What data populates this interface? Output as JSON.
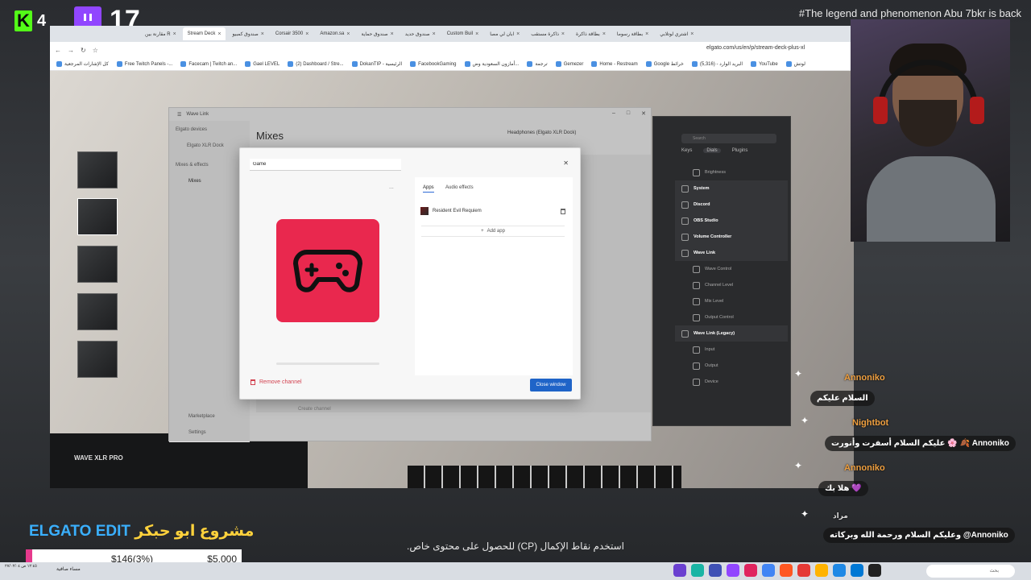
{
  "overlay": {
    "kick_count": "4",
    "twitch_count": "17",
    "banner": "#The legend and phenomenon Abu 7bkr is back"
  },
  "browser": {
    "url": "elgato.com/us/en/p/stream-deck-plus-xl",
    "tabs": [
      "مقارنة بين R",
      "Stream Deck",
      "صندوق كمبيو",
      "Corsair 3500",
      "Amazon.sa",
      "صندوق حماية",
      "صندوق حديد",
      "Custom Buil",
      "ابان لي مصا",
      "ذاكرة مستقب",
      "بطاقة ذاكرة",
      "بطاقة رسوما",
      "اشتري لوتلابي"
    ],
    "bookmarks": [
      "كل الإشارات المرجعية",
      "Free Twitch Panels -...",
      "Facecam | Twitch an...",
      "Gael LEVEL",
      "(2) Dashboard / Stre...",
      "DokanTIP - الرئيسية",
      "FacebookGaming",
      "أمازون السعودية وض...",
      "ترجمة",
      "Gemezer",
      "Home - Restream",
      "Google خرائط",
      "البريد الوارد - (5,316)",
      "YouTube",
      "لوتش"
    ]
  },
  "wave_link": {
    "window_title": "Wave Link",
    "sidebar": {
      "devices_heading": "Elgato devices",
      "device": "Elgato XLR Dock",
      "mixes_heading": "Mixes & effects",
      "mixes": "Mixes",
      "marketplace": "Marketplace",
      "settings": "Settings"
    },
    "header": "Mixes",
    "output": "Headphones (Elgato XLR Dock)",
    "mix_col": "at Mix",
    "create_channel": "Create channel"
  },
  "dialog": {
    "channel_name": "Game",
    "more": "...",
    "tabs": [
      "Apps",
      "Audio effects"
    ],
    "app_name": "Resident Evil Requiem",
    "add_app": "Add app",
    "remove_channel": "Remove channel",
    "close_window": "Close window",
    "icon_color": "#e9284e"
  },
  "stream_deck": {
    "search_placeholder": "Search",
    "tabs": [
      "Keys",
      "Dials",
      "Plugins"
    ],
    "items": [
      {
        "label": "Brightness",
        "level": "sub"
      },
      {
        "label": "System",
        "level": "top"
      },
      {
        "label": "Discord",
        "level": "top"
      },
      {
        "label": "OBS Studio",
        "level": "top"
      },
      {
        "label": "Volume Controller",
        "level": "top"
      },
      {
        "label": "Wave Link",
        "level": "top"
      },
      {
        "label": "Wave Control",
        "level": "sub"
      },
      {
        "label": "Channel Level",
        "level": "sub"
      },
      {
        "label": "Mix Level",
        "level": "sub"
      },
      {
        "label": "Output Control",
        "level": "sub"
      },
      {
        "label": "Wave Link (Legacy)",
        "level": "top"
      },
      {
        "label": "Input",
        "level": "sub"
      },
      {
        "label": "Output",
        "level": "sub"
      },
      {
        "label": "Device",
        "level": "sub"
      }
    ]
  },
  "device_label": "WAVE XLR PRO",
  "chat": [
    {
      "user": "Annoniko",
      "message": "السلام عليكم"
    },
    {
      "user": "Nightbot",
      "message": "عليكم السلام أسفرت وأنورت 🌸 🍂 Annoniko"
    },
    {
      "user": "Annoniko",
      "message": "هلا بك 💜"
    },
    {
      "user": "مراد",
      "message": "وعليكم السلام ورحمة الله وبركاته @Annoniko"
    }
  ],
  "bottom": {
    "project_title_a": "ELGATO EDIT",
    "project_title_b": "مشروع ابو حبكر",
    "donation_current": "$146(3%)",
    "donation_goal": "$5,000",
    "donation_fraction": 0.03,
    "cp_message": "استخدم نقاط الإكمال (CP) للحصول على محتوى خاص."
  },
  "taskbar": {
    "clock": "١٢:٤٥ ص ٢٧/٠٢/٠٤",
    "weather": "مساء صافية",
    "search_placeholder": "بحث"
  }
}
